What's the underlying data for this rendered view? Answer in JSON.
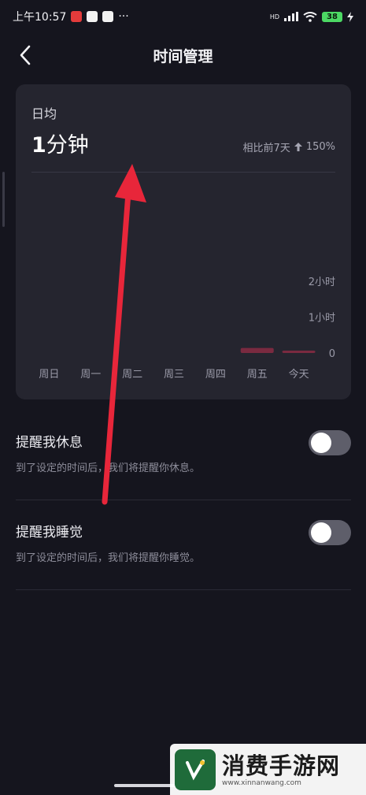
{
  "status_bar": {
    "time": "上午10:57",
    "more": "···",
    "network": "HD",
    "battery": "38"
  },
  "header": {
    "title": "时间管理"
  },
  "summary": {
    "label": "日均",
    "value_number": "1",
    "value_unit": "分钟",
    "compare_text": "相比前7天",
    "compare_change": "150%",
    "compare_direction": "up"
  },
  "chart_data": {
    "type": "bar",
    "categories": [
      "周日",
      "周一",
      "周二",
      "周三",
      "周四",
      "周五",
      "今天"
    ],
    "values": [
      0,
      0,
      0,
      0,
      0,
      0.14,
      0.05
    ],
    "y_ticks": [
      "2小时",
      "1小时",
      "0"
    ],
    "ylim": [
      0,
      2
    ],
    "y_unit": "hours",
    "bar_color": "#7a2a40",
    "grid": false
  },
  "settings": [
    {
      "title": "提醒我休息",
      "description": "到了设定的时间后，我们将提醒你休息。",
      "enabled": false
    },
    {
      "title": "提醒我睡觉",
      "description": "到了设定的时间后，我们将提醒你睡觉。",
      "enabled": false
    }
  ],
  "watermark": {
    "title": "消费手游网",
    "url": "www.xinnanwang.com"
  },
  "colors": {
    "background": "#15151e",
    "card": "#25252f",
    "annotation_arrow": "#e8263a"
  }
}
